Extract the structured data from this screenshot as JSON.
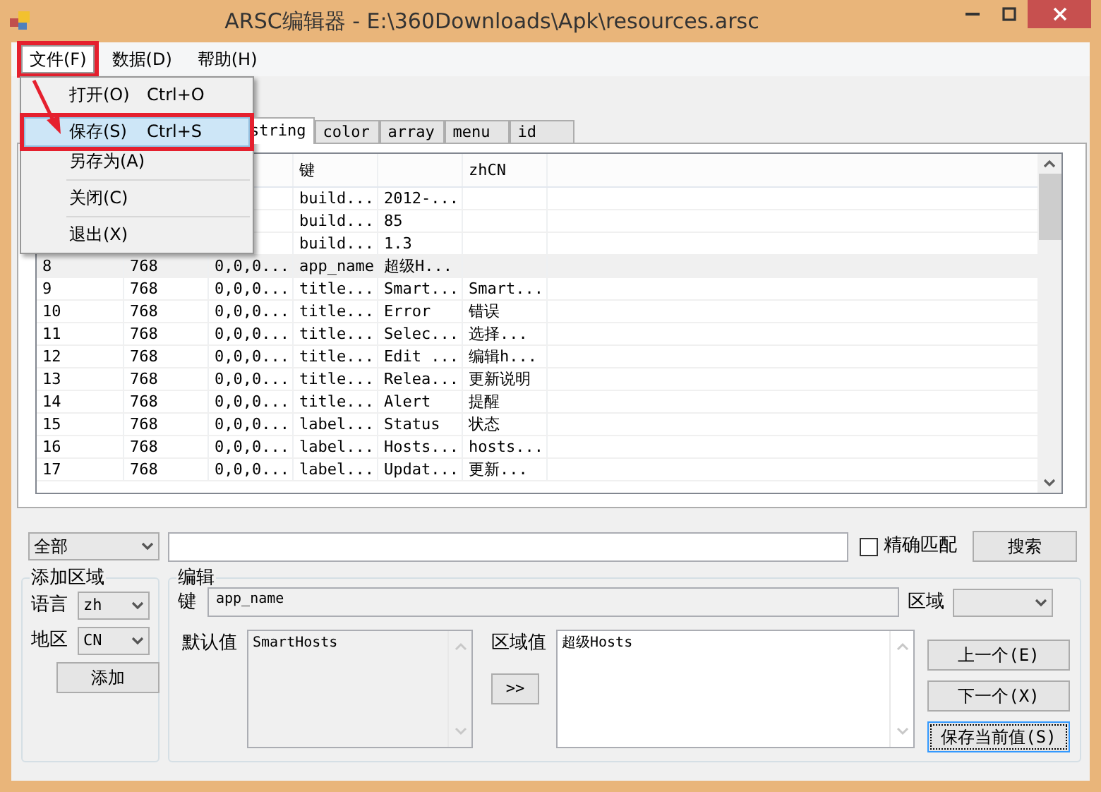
{
  "window": {
    "title": "ARSC编辑器 - E:\\360Downloads\\Apk\\resources.arsc"
  },
  "menu_bar": [
    {
      "label": "文件(F)",
      "selected": true,
      "annotated": true
    },
    {
      "label": "数据(D)",
      "selected": false,
      "annotated": false
    },
    {
      "label": "帮助(H)",
      "selected": false,
      "annotated": false
    }
  ],
  "file_menu": [
    {
      "kind": "item",
      "label": "打开(O)",
      "shortcut": "Ctrl+O",
      "selected": false,
      "annotated": false
    },
    {
      "kind": "separator"
    },
    {
      "kind": "item",
      "label": "保存(S)",
      "shortcut": "Ctrl+S",
      "selected": true,
      "annotated": true
    },
    {
      "kind": "item",
      "label": "另存为(A)",
      "selected": false,
      "annotated": false
    },
    {
      "kind": "separator"
    },
    {
      "kind": "item",
      "label": "关闭(C)",
      "selected": false,
      "annotated": false
    },
    {
      "kind": "separator"
    },
    {
      "kind": "item",
      "label": "退出(X)",
      "selected": false,
      "annotated": false
    }
  ],
  "tabs": [
    {
      "label": "string",
      "selected": true
    },
    {
      "label": "color",
      "selected": false
    },
    {
      "label": "array",
      "selected": false
    },
    {
      "label": "menu",
      "selected": false
    },
    {
      "label": "id",
      "selected": false
    }
  ],
  "table": {
    "header": {
      "column_4": "键",
      "column_6": "zhCN"
    },
    "rows": [
      {
        "selected": false,
        "column_4": "build...",
        "column_5": "2012-..."
      },
      {
        "selected": false,
        "column_4": "build...",
        "column_5": "85"
      },
      {
        "selected": false,
        "column_4": "build...",
        "column_5": "1.3"
      },
      {
        "selected": true,
        "column_1": "8",
        "column_2": "768",
        "column_3": "0,0,0...",
        "column_4": "app_name",
        "column_5": "超级H..."
      },
      {
        "selected": false,
        "column_1": "9",
        "column_2": "768",
        "column_3": "0,0,0...",
        "column_4": "title...",
        "column_5": "Smart...",
        "column_6": "Smart..."
      },
      {
        "selected": false,
        "column_1": "10",
        "column_2": "768",
        "column_3": "0,0,0...",
        "column_4": "title...",
        "column_5": "Error",
        "column_6": "错误"
      },
      {
        "selected": false,
        "column_1": "11",
        "column_2": "768",
        "column_3": "0,0,0...",
        "column_4": "title...",
        "column_5": "Selec...",
        "column_6": "选择..."
      },
      {
        "selected": false,
        "column_1": "12",
        "column_2": "768",
        "column_3": "0,0,0...",
        "column_4": "title...",
        "column_5": "Edit ...",
        "column_6": "编辑h..."
      },
      {
        "selected": false,
        "column_1": "13",
        "column_2": "768",
        "column_3": "0,0,0...",
        "column_4": "title...",
        "column_5": "Relea...",
        "column_6": "更新说明"
      },
      {
        "selected": false,
        "column_1": "14",
        "column_2": "768",
        "column_3": "0,0,0...",
        "column_4": "title...",
        "column_5": "Alert",
        "column_6": "提醒"
      },
      {
        "selected": false,
        "column_1": "15",
        "column_2": "768",
        "column_3": "0,0,0...",
        "column_4": "label...",
        "column_5": "Status",
        "column_6": "状态"
      },
      {
        "selected": false,
        "column_1": "16",
        "column_2": "768",
        "column_3": "0,0,0...",
        "column_4": "label...",
        "column_5": "Hosts...",
        "column_6": "hosts..."
      },
      {
        "selected": false,
        "column_1": "17",
        "column_2": "768",
        "column_3": "0,0,0...",
        "column_4": "label...",
        "column_5": "Updat...",
        "column_6": "更新..."
      }
    ]
  },
  "search": {
    "scope": "全部",
    "exact_match": {
      "label": "精确匹配",
      "checked": false
    },
    "button": "搜索"
  },
  "add_region": {
    "title": "添加区域",
    "language_label": "语言",
    "language": "zh",
    "region_label": "地区",
    "region": "CN",
    "button": "添加"
  },
  "edit": {
    "title": "编辑",
    "key_label": "键",
    "key": "app_name",
    "region_label": "区域",
    "default_label": "默认值",
    "default_value": "SmartHosts",
    "copy_button": ">>",
    "region_value_label": "区域值",
    "region_value": "超级Hosts",
    "buttons": [
      {
        "label": "上一个(E)",
        "focused": false
      },
      {
        "label": "下一个(X)",
        "focused": false
      },
      {
        "label": "保存当前值(S)",
        "focused": true
      }
    ]
  }
}
